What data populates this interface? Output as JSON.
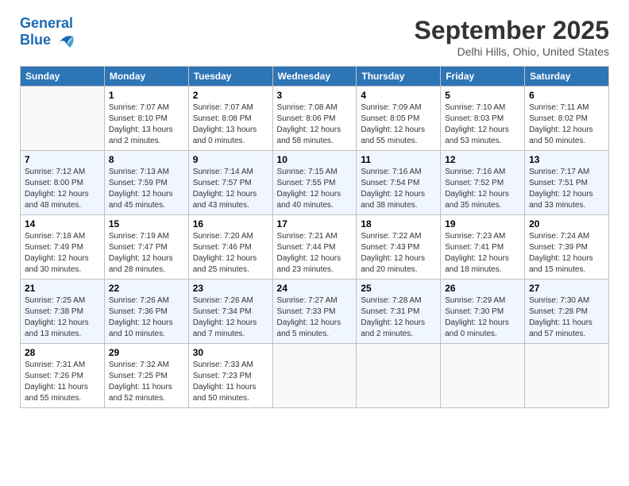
{
  "header": {
    "logo_line1": "General",
    "logo_line2": "Blue",
    "month": "September 2025",
    "location": "Delhi Hills, Ohio, United States"
  },
  "days_of_week": [
    "Sunday",
    "Monday",
    "Tuesday",
    "Wednesday",
    "Thursday",
    "Friday",
    "Saturday"
  ],
  "weeks": [
    [
      {
        "day": "",
        "info": ""
      },
      {
        "day": "1",
        "info": "Sunrise: 7:07 AM\nSunset: 8:10 PM\nDaylight: 13 hours\nand 2 minutes."
      },
      {
        "day": "2",
        "info": "Sunrise: 7:07 AM\nSunset: 8:08 PM\nDaylight: 13 hours\nand 0 minutes."
      },
      {
        "day": "3",
        "info": "Sunrise: 7:08 AM\nSunset: 8:06 PM\nDaylight: 12 hours\nand 58 minutes."
      },
      {
        "day": "4",
        "info": "Sunrise: 7:09 AM\nSunset: 8:05 PM\nDaylight: 12 hours\nand 55 minutes."
      },
      {
        "day": "5",
        "info": "Sunrise: 7:10 AM\nSunset: 8:03 PM\nDaylight: 12 hours\nand 53 minutes."
      },
      {
        "day": "6",
        "info": "Sunrise: 7:11 AM\nSunset: 8:02 PM\nDaylight: 12 hours\nand 50 minutes."
      }
    ],
    [
      {
        "day": "7",
        "info": "Sunrise: 7:12 AM\nSunset: 8:00 PM\nDaylight: 12 hours\nand 48 minutes."
      },
      {
        "day": "8",
        "info": "Sunrise: 7:13 AM\nSunset: 7:59 PM\nDaylight: 12 hours\nand 45 minutes."
      },
      {
        "day": "9",
        "info": "Sunrise: 7:14 AM\nSunset: 7:57 PM\nDaylight: 12 hours\nand 43 minutes."
      },
      {
        "day": "10",
        "info": "Sunrise: 7:15 AM\nSunset: 7:55 PM\nDaylight: 12 hours\nand 40 minutes."
      },
      {
        "day": "11",
        "info": "Sunrise: 7:16 AM\nSunset: 7:54 PM\nDaylight: 12 hours\nand 38 minutes."
      },
      {
        "day": "12",
        "info": "Sunrise: 7:16 AM\nSunset: 7:52 PM\nDaylight: 12 hours\nand 35 minutes."
      },
      {
        "day": "13",
        "info": "Sunrise: 7:17 AM\nSunset: 7:51 PM\nDaylight: 12 hours\nand 33 minutes."
      }
    ],
    [
      {
        "day": "14",
        "info": "Sunrise: 7:18 AM\nSunset: 7:49 PM\nDaylight: 12 hours\nand 30 minutes."
      },
      {
        "day": "15",
        "info": "Sunrise: 7:19 AM\nSunset: 7:47 PM\nDaylight: 12 hours\nand 28 minutes."
      },
      {
        "day": "16",
        "info": "Sunrise: 7:20 AM\nSunset: 7:46 PM\nDaylight: 12 hours\nand 25 minutes."
      },
      {
        "day": "17",
        "info": "Sunrise: 7:21 AM\nSunset: 7:44 PM\nDaylight: 12 hours\nand 23 minutes."
      },
      {
        "day": "18",
        "info": "Sunrise: 7:22 AM\nSunset: 7:43 PM\nDaylight: 12 hours\nand 20 minutes."
      },
      {
        "day": "19",
        "info": "Sunrise: 7:23 AM\nSunset: 7:41 PM\nDaylight: 12 hours\nand 18 minutes."
      },
      {
        "day": "20",
        "info": "Sunrise: 7:24 AM\nSunset: 7:39 PM\nDaylight: 12 hours\nand 15 minutes."
      }
    ],
    [
      {
        "day": "21",
        "info": "Sunrise: 7:25 AM\nSunset: 7:38 PM\nDaylight: 12 hours\nand 13 minutes."
      },
      {
        "day": "22",
        "info": "Sunrise: 7:26 AM\nSunset: 7:36 PM\nDaylight: 12 hours\nand 10 minutes."
      },
      {
        "day": "23",
        "info": "Sunrise: 7:26 AM\nSunset: 7:34 PM\nDaylight: 12 hours\nand 7 minutes."
      },
      {
        "day": "24",
        "info": "Sunrise: 7:27 AM\nSunset: 7:33 PM\nDaylight: 12 hours\nand 5 minutes."
      },
      {
        "day": "25",
        "info": "Sunrise: 7:28 AM\nSunset: 7:31 PM\nDaylight: 12 hours\nand 2 minutes."
      },
      {
        "day": "26",
        "info": "Sunrise: 7:29 AM\nSunset: 7:30 PM\nDaylight: 12 hours\nand 0 minutes."
      },
      {
        "day": "27",
        "info": "Sunrise: 7:30 AM\nSunset: 7:28 PM\nDaylight: 11 hours\nand 57 minutes."
      }
    ],
    [
      {
        "day": "28",
        "info": "Sunrise: 7:31 AM\nSunset: 7:26 PM\nDaylight: 11 hours\nand 55 minutes."
      },
      {
        "day": "29",
        "info": "Sunrise: 7:32 AM\nSunset: 7:25 PM\nDaylight: 11 hours\nand 52 minutes."
      },
      {
        "day": "30",
        "info": "Sunrise: 7:33 AM\nSunset: 7:23 PM\nDaylight: 11 hours\nand 50 minutes."
      },
      {
        "day": "",
        "info": ""
      },
      {
        "day": "",
        "info": ""
      },
      {
        "day": "",
        "info": ""
      },
      {
        "day": "",
        "info": ""
      }
    ]
  ]
}
